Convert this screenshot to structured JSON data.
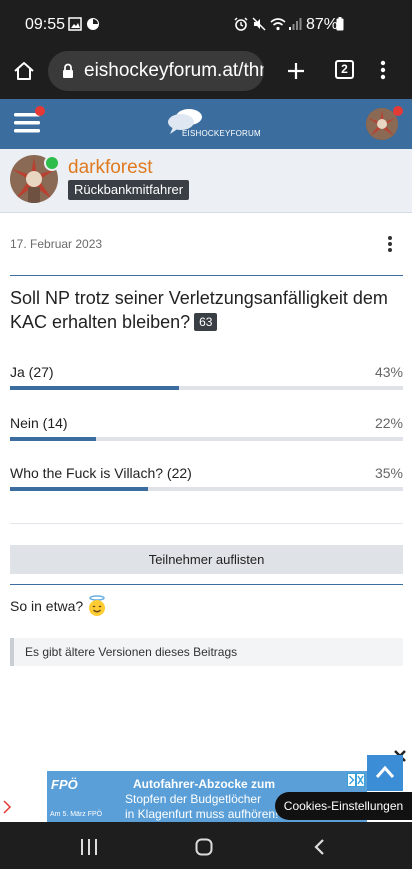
{
  "status_bar": {
    "time": "09:55",
    "battery": "87%"
  },
  "browser": {
    "url": "eishockeyforum.at/thr",
    "tab_count": "2"
  },
  "site": {
    "logo_text": "EISHOCKEYFORUM"
  },
  "author": {
    "name": "darkforest",
    "role": "Rückbankmitfahrer"
  },
  "post": {
    "date": "17. Februar 2023",
    "poll": {
      "question": "Soll NP trotz seiner Verletzungsanfälligkeit dem KAC erhalten bleiben?",
      "votes": "63",
      "options": [
        {
          "label": "Ja (27)",
          "percent": "43%",
          "fraction": 0.43
        },
        {
          "label": "Nein (14)",
          "percent": "22%",
          "fraction": 0.22
        },
        {
          "label": "Who the Fuck is Villach? (22)",
          "percent": "35%",
          "fraction": 0.35
        }
      ],
      "list_button": "Teilnehmer auflisten"
    },
    "text": "So in etwa?",
    "older_versions_notice": "Es gibt ältere Versionen dieses Beitrags"
  },
  "ad": {
    "brand": "FPÖ",
    "headline": "Autofahrer-Abzocke zum",
    "line2": "Stopfen der Budgetlöcher",
    "line3": "in Klagenfurt muss aufhören!",
    "small": "Am 5. März FPÖ"
  },
  "cookie_button": "Cookies-Einstellungen",
  "colors": {
    "accent": "#3b6e9f",
    "author_name": "#e07a1f",
    "online": "#2ebd4a"
  }
}
